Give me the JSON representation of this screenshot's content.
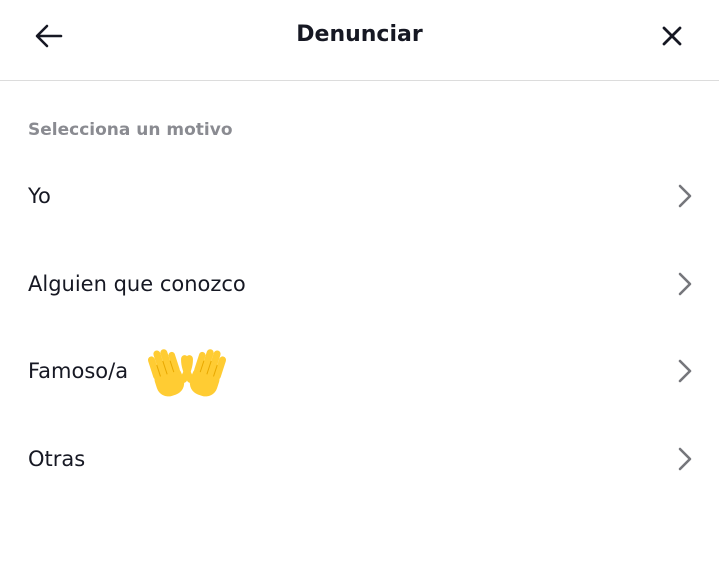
{
  "header": {
    "title": "Denunciar",
    "back_icon": "arrow-left-icon",
    "close_icon": "close-icon"
  },
  "section": {
    "label": "Selecciona un motivo"
  },
  "reasons": [
    {
      "label": "Yo"
    },
    {
      "label": "Alguien que conozco"
    },
    {
      "label": "Famoso/a"
    },
    {
      "label": "Otras"
    }
  ],
  "decoration": {
    "emoji": "raised-hands-emoji"
  },
  "colors": {
    "text": "#161823",
    "muted": "#8a8b91",
    "divider": "#dcdcdc",
    "chevron": "#75767b",
    "emoji": "#FFCC33"
  }
}
